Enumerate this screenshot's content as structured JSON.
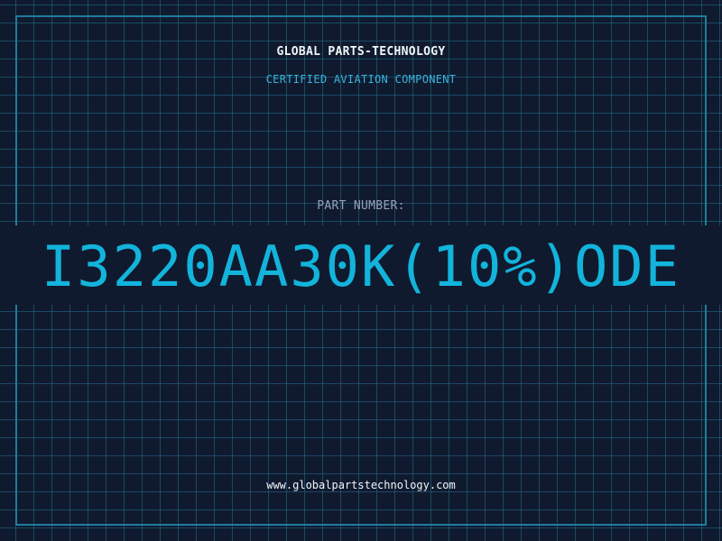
{
  "header": {
    "brand": "GLOBAL PARTS-TECHNOLOGY",
    "subtitle": "CERTIFIED AVIATION COMPONENT"
  },
  "part": {
    "label": "PART NUMBER:",
    "number": "I3220AA30K(10%)ODE"
  },
  "footer": {
    "website": "www.globalpartstechnology.com"
  },
  "colors": {
    "background": "#101a2e",
    "grid": "#246e8c",
    "accent": "#12b4dc",
    "text": "#f1f5f9",
    "muted": "#94a3b8"
  }
}
